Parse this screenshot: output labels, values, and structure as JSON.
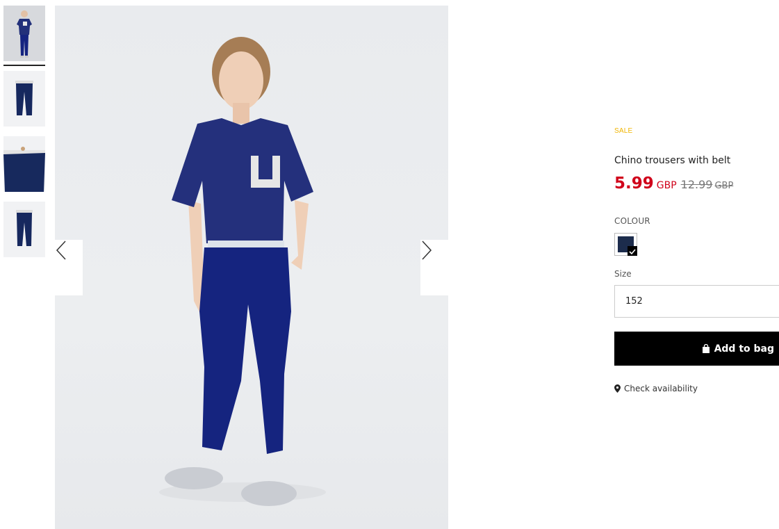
{
  "gallery": {
    "thumbnails": [
      {
        "name": "model-front",
        "selected": true
      },
      {
        "name": "trousers-front"
      },
      {
        "name": "trousers-detail"
      },
      {
        "name": "trousers-back"
      }
    ],
    "prev_icon": "chevron-left-icon",
    "next_icon": "chevron-right-icon"
  },
  "product": {
    "badge": "SALE",
    "title": "Chino trousers with belt",
    "price": "5.99",
    "currency": "GBP",
    "old_price": "12.99",
    "old_currency": "GBP",
    "colour_label": "COLOUR",
    "colour_hex": "#1c2c4c",
    "size_label": "Size",
    "size_value": "152",
    "add_to_bag": "Add to bag",
    "check_availability": "Check availability"
  },
  "colors": {
    "sale": "#f0b400",
    "price": "#d0021b",
    "button": "#000000",
    "trousers": "#14237a"
  }
}
